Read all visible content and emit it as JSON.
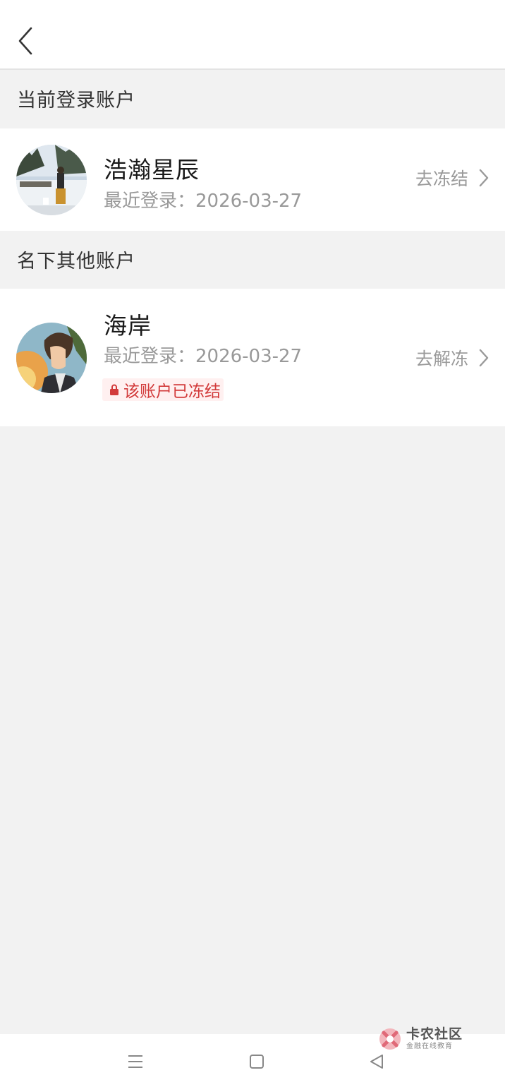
{
  "header": {
    "back_icon": "chevron-left-icon"
  },
  "sections": {
    "current_title": "当前登录账户",
    "others_title": "名下其他账户"
  },
  "current_account": {
    "name": "浩瀚星辰",
    "last_login": "最近登录：2026-03-27",
    "action_label": "去冻结",
    "action_icon": "chevron-right-icon"
  },
  "other_accounts": [
    {
      "name": "海岸",
      "last_login": "最近登录：2026-03-27",
      "action_label": "去解冻",
      "action_icon": "chevron-right-icon",
      "status_label": "该账户已冻结",
      "status_icon": "lock-icon",
      "status_color": "#d23a3a"
    }
  ],
  "watermark": {
    "brand": "卡农社区",
    "slogan": "金融在线教育"
  },
  "navbar": {
    "icons": [
      "menu-icon",
      "home-square-icon",
      "back-triangle-icon"
    ]
  },
  "colors": {
    "background": "#f2f2f2",
    "card": "#ffffff",
    "frozen_bg": "#fff0f0",
    "frozen_text": "#d23a3a"
  }
}
